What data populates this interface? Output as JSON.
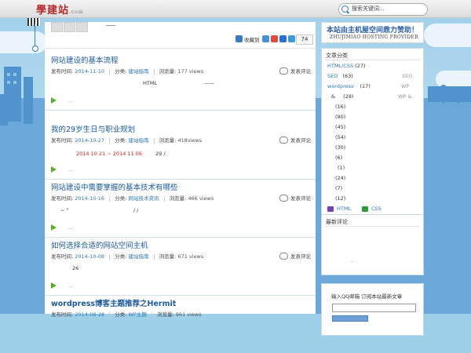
{
  "site": {
    "logo": "學建站",
    "logo_suffix": ".com",
    "nav_faint": [
      "???",
      "???",
      "???",
      "???"
    ]
  },
  "search": {
    "placeholder": "搜索关键词..."
  },
  "main": {
    "share_label": "收藏到",
    "share_count": "74",
    "posts": [
      {
        "title": "网站建设的基本流程",
        "date_label": "发布时间:",
        "date": "2014-11-10",
        "cat_label": "分类:",
        "category": "建站指南",
        "views_label": "浏览量:",
        "views": "177 views",
        "comment": "发表评论",
        "excerpt": [
          "HTML",
          "——"
        ],
        "more": "..."
      },
      {
        "title": "我的29岁生日与职业规划",
        "date_label": "发布时间:",
        "date": "2014-10-27",
        "cat_label": "分类:",
        "category": "建站指南",
        "views_label": "浏览量:",
        "views": "418views",
        "comment": "发表评论",
        "excerpt_red": "2014 10 21  ~ 2014 11 06",
        "excerpt_tail": "29 /",
        "more": "..."
      },
      {
        "title": "网站建设中需要掌握的基本技术有哪些",
        "date_label": "发布时间:",
        "date": "2014-10-16",
        "cat_label": "分类:",
        "category": "网站技术资讯",
        "views_label": "浏览量:",
        "views": "466 views",
        "comment": "发表评论",
        "excerpt": [
          "~ \"",
          "/ /"
        ],
        "more": "..."
      },
      {
        "title": "如何选择合适的网站空间主机",
        "date_label": "发布时间:",
        "date": "2014-10-08",
        "cat_label": "分类:",
        "category": "建站指南",
        "views_label": "浏览量:",
        "views": "671 views",
        "comment": "发表评论",
        "excerpt": [
          "26"
        ],
        "more": "..."
      },
      {
        "title": "wordpress博客主题推荐之Hermit",
        "date_label": "发布时间:",
        "date": "2014-08-28",
        "cat_label": "分类:",
        "category": "WP主题",
        "views_label": "浏览量:",
        "views": "961 views"
      }
    ]
  },
  "sidebar": {
    "banner_top": "本站由主机屋空间鼎力赞助！",
    "banner_bottom": "ZHUJIMIAO HOSTING PROVIDER",
    "categories_title": "文章分类",
    "categories": [
      {
        "link": "HTML/CSS",
        "num": "(27)",
        "faint": ""
      },
      {
        "link": "SEO",
        "num": "(63)",
        "faint": "SEO"
      },
      {
        "link": "wordpress",
        "num": "(17)",
        "faint": "WP"
      },
      {
        "link": "&",
        "num": "(28)",
        "faint": "WP &"
      },
      {
        "link": "",
        "num": "(16)",
        "faint": ""
      },
      {
        "link": "",
        "num": "(90)",
        "faint": ""
      },
      {
        "link": "",
        "num": "(45)",
        "faint": ""
      },
      {
        "link": "",
        "num": "(54)",
        "faint": ""
      },
      {
        "link": "",
        "num": "(30)",
        "faint": ""
      },
      {
        "link": "",
        "num": "(6)",
        "faint": ""
      },
      {
        "link": "",
        "num": "(1)",
        "faint": ""
      },
      {
        "link": "",
        "num": "(24)",
        "faint": ""
      },
      {
        "link": "",
        "num": "(7)",
        "faint": ""
      },
      {
        "link": "",
        "num": "(12)",
        "faint": ""
      }
    ],
    "tags": [
      {
        "label": "HTML",
        "color": "#7a3fb0"
      },
      {
        "label": "CSS",
        "color": "#2f9a3a"
      }
    ],
    "recent_title": "最新评论",
    "recent_more": "...",
    "qq_title": "输入QQ邮箱 订阅本站最新文章"
  },
  "colors": {
    "link": "#1c5a9a",
    "accent_green": "#5ab031",
    "sky": "#9fd0ea",
    "logo_red": "#b52a2a"
  }
}
